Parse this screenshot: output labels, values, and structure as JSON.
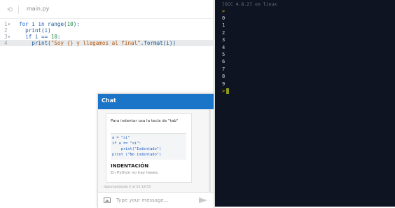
{
  "editor": {
    "tab_icon": "file-refresh-icon",
    "filename": "main.py",
    "gutter": [
      "1",
      "2",
      "3",
      "4"
    ],
    "arrows": [
      "▾",
      "",
      "▾",
      ""
    ],
    "lines": [
      {
        "parts": [
          [
            "kw",
            "for"
          ],
          [
            "",
            " i "
          ],
          [
            "kw",
            "in"
          ],
          [
            "",
            " range("
          ],
          [
            "num",
            "10"
          ],
          [
            "",
            "):"
          ]
        ]
      },
      {
        "parts": [
          [
            "",
            "  print(i)"
          ]
        ]
      },
      {
        "parts": [
          [
            "",
            "  "
          ],
          [
            "kw",
            "if"
          ],
          [
            "",
            " i == "
          ],
          [
            "num",
            "10"
          ],
          [
            "",
            ":"
          ]
        ]
      },
      {
        "parts": [
          [
            "",
            "    print("
          ],
          [
            "str",
            "\"Soy {} y llegamos al final\""
          ],
          [
            "",
            ".format(i))"
          ]
        ]
      }
    ]
  },
  "console": {
    "header": "[GCC 4.8.2] on linux",
    "header_prompt": ">",
    "outputs": [
      "0",
      "1",
      "2",
      "3",
      "4",
      "5",
      "6",
      "7",
      "8",
      "9"
    ],
    "prompt": ">"
  },
  "chat": {
    "title": "Chat",
    "message_text": "Para indentar usa la tecla de \"tab\"",
    "code_lines": [
      "a = \"si\"",
      "if a == \"si\":",
      "    print(\"Indentado\")",
      "print (\"No indentado\")"
    ],
    "card_heading": "INDENTACIÓN",
    "card_subtitle": "En Python no hay llaves.",
    "meta": "diplomadotodo // at 01:18:55",
    "input_placeholder": "Type your message...",
    "image_icon": "image-icon",
    "send_icon": "send-icon"
  },
  "colors": {
    "chat_header": "#1a74c7",
    "console_bg": "#0f1423",
    "prompt": "#e5b800"
  }
}
